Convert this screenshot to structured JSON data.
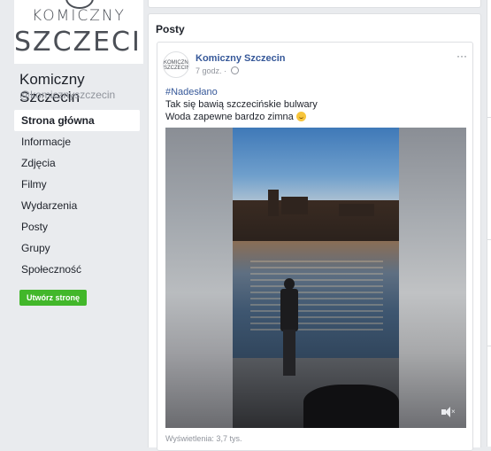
{
  "logo": {
    "line1": "KOMICZNY",
    "line2": "SZCZECIN"
  },
  "page": {
    "name": "Komiczny Szczecin",
    "handle": "@komicznyszczecin"
  },
  "nav": [
    {
      "label": "Strona główna",
      "active": true
    },
    {
      "label": "Informacje"
    },
    {
      "label": "Zdjęcia"
    },
    {
      "label": "Filmy"
    },
    {
      "label": "Wydarzenia"
    },
    {
      "label": "Posty"
    },
    {
      "label": "Grupy"
    },
    {
      "label": "Społeczność"
    }
  ],
  "create_button": "Utwórz stronę",
  "posts": {
    "header": "Posty",
    "post": {
      "author": "Komiczny Szczecin",
      "time": "7 godz.",
      "separator": "·",
      "more": "···",
      "avatar_text": "KOMICZNY SZCZECIN",
      "hashtag": "#Nadesłano",
      "line1": "Tak się bawią szczecińskie bulwary",
      "line2": "Woda zapewne bardzo zimna",
      "views": "Wyświetlenia: 3,7 tys."
    }
  },
  "icons": {
    "globe": "globe-icon",
    "mute": "mute-icon",
    "more": "more-icon",
    "emoji": "smile-emoji-icon"
  },
  "colors": {
    "link": "#365899",
    "green_button": "#42b72a",
    "background": "#e9ebee"
  }
}
